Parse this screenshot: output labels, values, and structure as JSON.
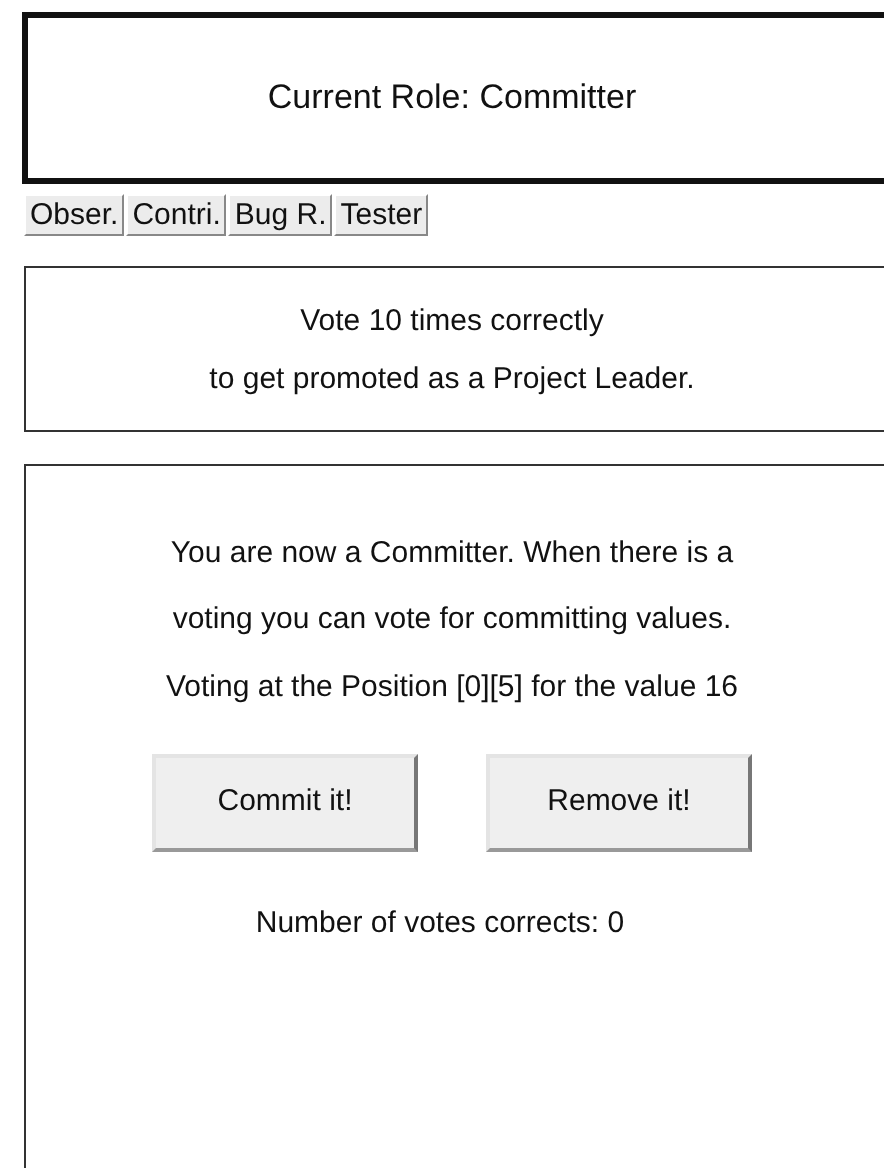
{
  "role_header": {
    "text": "Current Role: Committer"
  },
  "role_tabs": [
    {
      "label": "Obser."
    },
    {
      "label": "Contri."
    },
    {
      "label": "Bug R."
    },
    {
      "label": "Tester"
    }
  ],
  "promotion": {
    "lines": [
      "Vote 10 times correctly",
      "to get promoted as a Project Leader."
    ]
  },
  "voting_panel": {
    "intro_lines": [
      "You are now a Committer. When there is a",
      "voting you can vote for committing values."
    ],
    "voting_info": "Voting at the Position [0][5] for the value 16",
    "buttons": [
      {
        "label": "Commit it!"
      },
      {
        "label": "Remove it!"
      }
    ],
    "vote_count": "Number of votes corrects: 0"
  }
}
